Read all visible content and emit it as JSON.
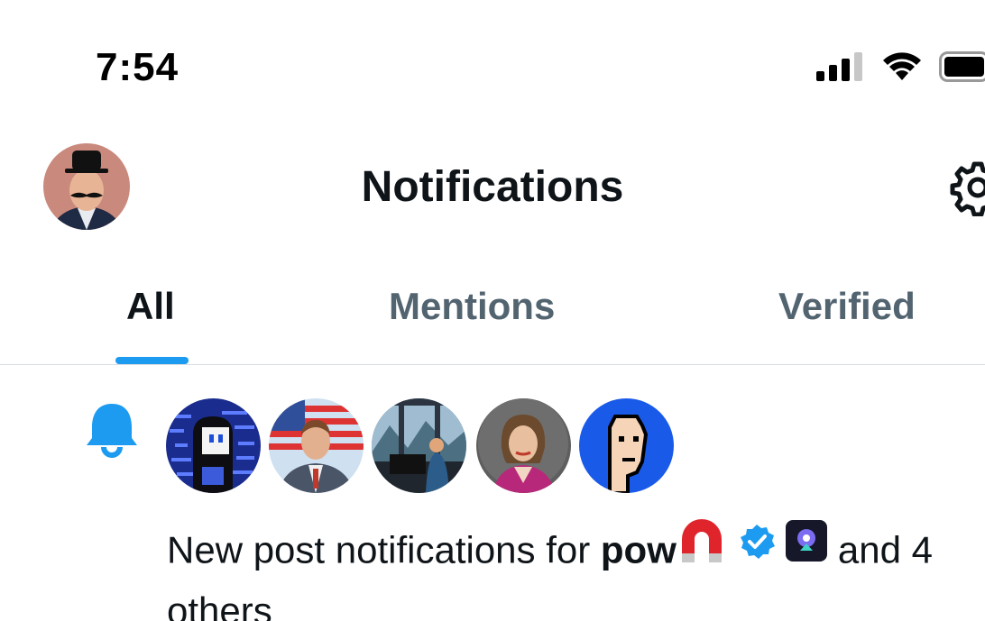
{
  "status_bar": {
    "time": "7:54",
    "icons": [
      "cellular-signal-icon",
      "wifi-icon",
      "battery-icon"
    ]
  },
  "header": {
    "title": "Notifications",
    "avatar": "profile-avatar",
    "settings_icon": "gear-icon"
  },
  "tabs": [
    {
      "label": "All",
      "active": true
    },
    {
      "label": "Mentions",
      "active": false
    },
    {
      "label": "Verified",
      "active": false
    }
  ],
  "notification": {
    "icon": "bell-icon",
    "avatars": [
      "avatar-1",
      "avatar-2",
      "avatar-3",
      "avatar-4",
      "avatar-5"
    ],
    "text_prefix": "New post notifications for ",
    "username": "pow",
    "emoji": "magnet-icon",
    "badges": [
      "verified-badge-icon",
      "app-icon"
    ],
    "text_suffix": " and 4",
    "text_line2": "others"
  },
  "colors": {
    "accent": "#1d9bf0",
    "text_primary": "#0f1419",
    "text_secondary": "#536471",
    "divider": "#d9dee2"
  }
}
